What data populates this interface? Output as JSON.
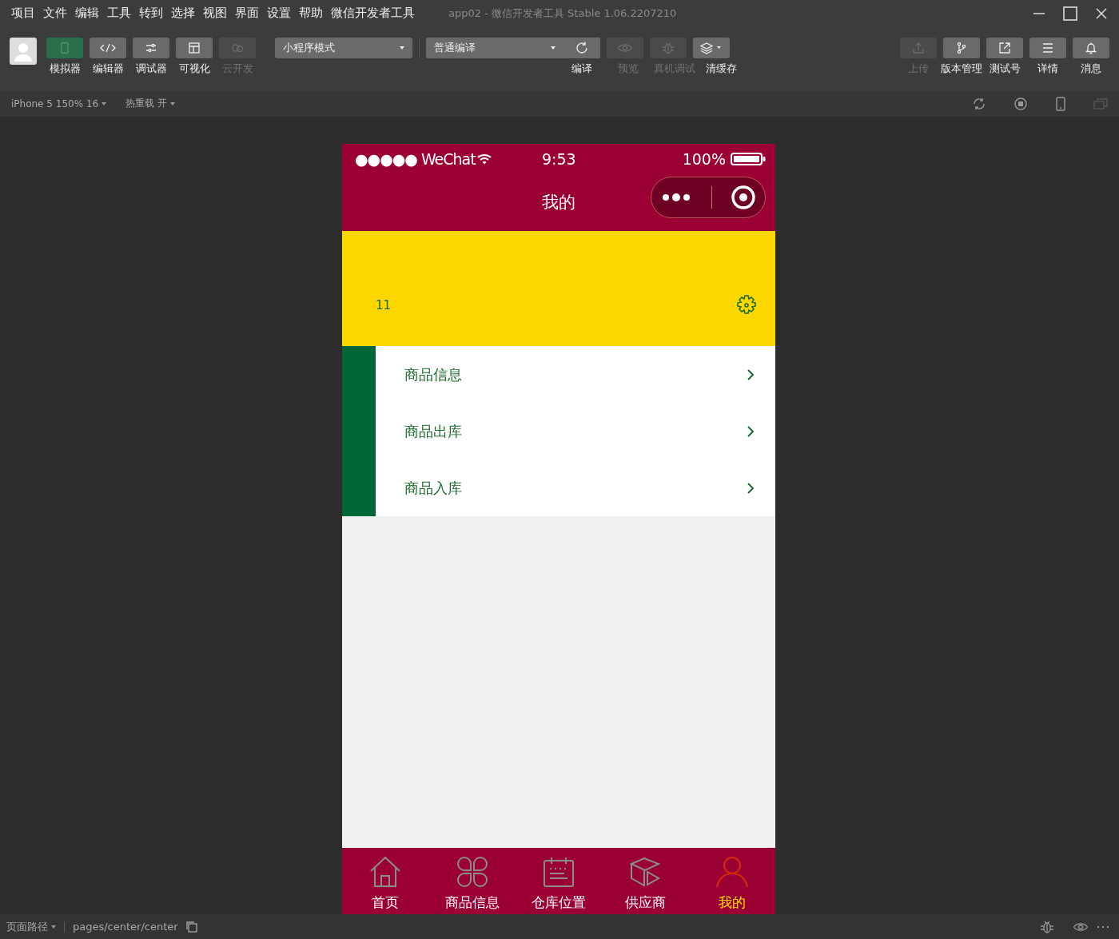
{
  "menu": [
    "项目",
    "文件",
    "编辑",
    "工具",
    "转到",
    "选择",
    "视图",
    "界面",
    "设置",
    "帮助",
    "微信开发者工具"
  ],
  "window": {
    "title": "app02 - 微信开发者工具 Stable 1.06.2207210"
  },
  "toolbar": {
    "views": [
      {
        "label": "模拟器",
        "selected": true,
        "disabled": false
      },
      {
        "label": "编辑器",
        "selected": false,
        "disabled": false
      },
      {
        "label": "调试器",
        "selected": false,
        "disabled": false
      },
      {
        "label": "可视化",
        "selected": false,
        "disabled": false
      },
      {
        "label": "云开发",
        "selected": false,
        "disabled": true
      }
    ],
    "mode_dropdown": "小程序模式",
    "compile_dropdown": "普通编译",
    "compile_actions": [
      {
        "label": "编译",
        "disabled": false
      },
      {
        "label": "预览",
        "disabled": true
      },
      {
        "label": "真机调试",
        "disabled": true
      },
      {
        "label": "清缓存",
        "disabled": false
      }
    ],
    "right_actions": [
      {
        "label": "上传",
        "disabled": true
      },
      {
        "label": "版本管理",
        "disabled": false
      },
      {
        "label": "测试号",
        "disabled": false
      },
      {
        "label": "详情",
        "disabled": false
      },
      {
        "label": "消息",
        "disabled": false
      }
    ]
  },
  "sim_bar": {
    "device": "iPhone 5 150% 16",
    "hot_reload": "热重载 开"
  },
  "phone": {
    "status": {
      "carrier": "●●●●● WeChat",
      "time": "9:53",
      "battery": "100%"
    },
    "nav_title": "我的",
    "header": {
      "user": "11"
    },
    "menu_items": [
      "商品信息",
      "商品出库",
      "商品入库"
    ],
    "tabs": [
      {
        "label": "首页",
        "selected": false
      },
      {
        "label": "商品信息",
        "selected": false
      },
      {
        "label": "仓库位置",
        "selected": false
      },
      {
        "label": "供应商",
        "selected": false
      },
      {
        "label": "我的",
        "selected": true
      }
    ]
  },
  "status_bar": {
    "path_label": "页面路径",
    "path": "pages/center/center"
  }
}
